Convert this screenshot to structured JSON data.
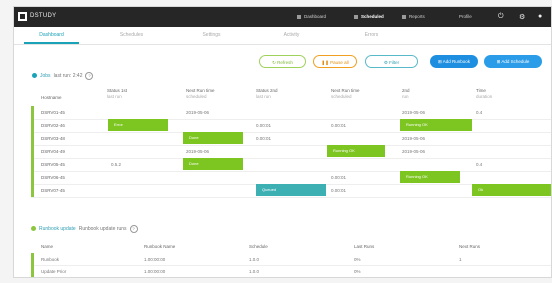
{
  "app": {
    "brand": "DSTUDY",
    "nav": [
      {
        "label": "Dashboard",
        "active": false
      },
      {
        "label": "Scheduled",
        "active": true
      },
      {
        "label": "Reports",
        "active": false
      },
      {
        "label": "Profile",
        "active": false
      }
    ],
    "icons": [
      "power-icon",
      "gear-icon",
      "user-icon"
    ]
  },
  "tabs": [
    {
      "label": "Dashboard",
      "active": true
    },
    {
      "label": "Schedules",
      "active": false
    },
    {
      "label": "Settings",
      "active": false
    },
    {
      "label": "Activity",
      "active": false
    },
    {
      "label": "Errors",
      "active": false
    }
  ],
  "toolbar": {
    "refresh": "Refresh",
    "pause": "Pause all",
    "filter": "Filter",
    "add_runbook": "Add Runbook",
    "add_schedule": "Add Schedule"
  },
  "section1": {
    "title": "Jobs",
    "subtitle": "last run: 2:42"
  },
  "columns": [
    {
      "title": "Hostname",
      "sub": ""
    },
    {
      "title": "Status 1st",
      "sub": "last run"
    },
    {
      "title": "Next Run time",
      "sub": "scheduled"
    },
    {
      "title": "Status 2nd",
      "sub": "last run"
    },
    {
      "title": "Next Run time",
      "sub": "scheduled"
    },
    {
      "title": "2nd",
      "sub": "run"
    },
    {
      "title": "Time",
      "sub": "duration"
    }
  ],
  "rows": [
    {
      "host": "DSRV01-45",
      "c2": "",
      "c3": "2019-05-06",
      "c4": "",
      "c5": "",
      "c6": "2019-05-06",
      "c7": "0.4"
    },
    {
      "host": "DSRV02-46",
      "c2": "",
      "c3": "",
      "c4": "0.00:01",
      "c5": "0.00:01",
      "c6": "",
      "c7": ""
    },
    {
      "host": "DSRV03-48",
      "c2": "",
      "c3": "",
      "c4": "0.00:01",
      "c5": "",
      "c6": "2019-05-06",
      "c7": ""
    },
    {
      "host": "DSRV04-49",
      "c2": "",
      "c3": "2019-05-06",
      "c4": "",
      "c5": "",
      "c6": "2019-05-06",
      "c7": ""
    },
    {
      "host": "DSRV05-45",
      "c2": "0.5.2",
      "c3": "",
      "c4": "",
      "c5": "",
      "c6": "",
      "c7": "0.4"
    },
    {
      "host": "DSRV06-45",
      "c2": "",
      "c3": "",
      "c4": "",
      "c5": "0.00:01",
      "c6": "",
      "c7": ""
    },
    {
      "host": "DSRV07-45",
      "c2": "",
      "c3": "",
      "c4": "",
      "c5": "0.00:01",
      "c6": "",
      "c7": ""
    }
  ],
  "blocks": [
    {
      "label": "Error",
      "color": "green"
    },
    {
      "label": "Running OK",
      "color": "green"
    },
    {
      "label": "Done",
      "color": "green"
    },
    {
      "label": "Running OK",
      "color": "green"
    },
    {
      "label": "Done",
      "color": "green"
    },
    {
      "label": "Running OK",
      "color": "green"
    },
    {
      "label": "Done",
      "color": "green"
    },
    {
      "label": "Queued",
      "color": "teal"
    },
    {
      "label": "Ok",
      "color": "green"
    }
  ],
  "section2": {
    "title": "Runbook update",
    "subtitle": "Runbook update runs",
    "columns": [
      "Name",
      "Runbook Name",
      "Schedule",
      "Last Runs",
      "Next Runs"
    ],
    "rows": [
      {
        "name": "Runbook",
        "rb": "1.00:00:00",
        "sched": "1.0.0",
        "last": "0%",
        "next": "1"
      },
      {
        "name": "Update Prior",
        "rb": "1.00:00:00",
        "sched": "1.0.0",
        "last": "0%",
        "next": ""
      }
    ]
  },
  "colors": {
    "accent": "#1aa3b8",
    "green": "#7dc520",
    "teal": "#3cb0b3",
    "topbar": "#262626"
  }
}
